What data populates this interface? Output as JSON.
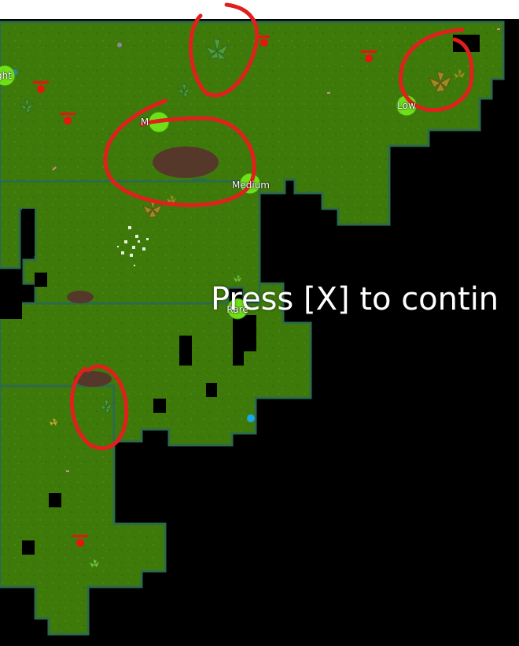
{
  "colors": {
    "grass": "#3e7a0a",
    "grass_edge": "#2c6b4a",
    "dirt": "#55382a",
    "void": "#000000",
    "annotation": "#e0201c",
    "resource_node": "#6ee017",
    "enemy": "#e8140f",
    "ui_text": "#ffffff",
    "top_bar": "#ffffff"
  },
  "prompt": {
    "text": "Press [X] to contin"
  },
  "markers": [
    {
      "name": "resource-node-light",
      "label": "ght"
    },
    {
      "name": "resource-node-medium-top",
      "label": "M"
    },
    {
      "name": "resource-node-medium",
      "label": "Medium"
    },
    {
      "name": "resource-node-low",
      "label": "Low"
    },
    {
      "name": "resource-node-rare",
      "label": "Rare"
    }
  ],
  "icons": {
    "enemy": "red-creature-icon",
    "plant": "leafy-plant-icon",
    "wood": "woody-plant-icon",
    "rock": "rock-icon",
    "water": "water-drop-icon"
  }
}
